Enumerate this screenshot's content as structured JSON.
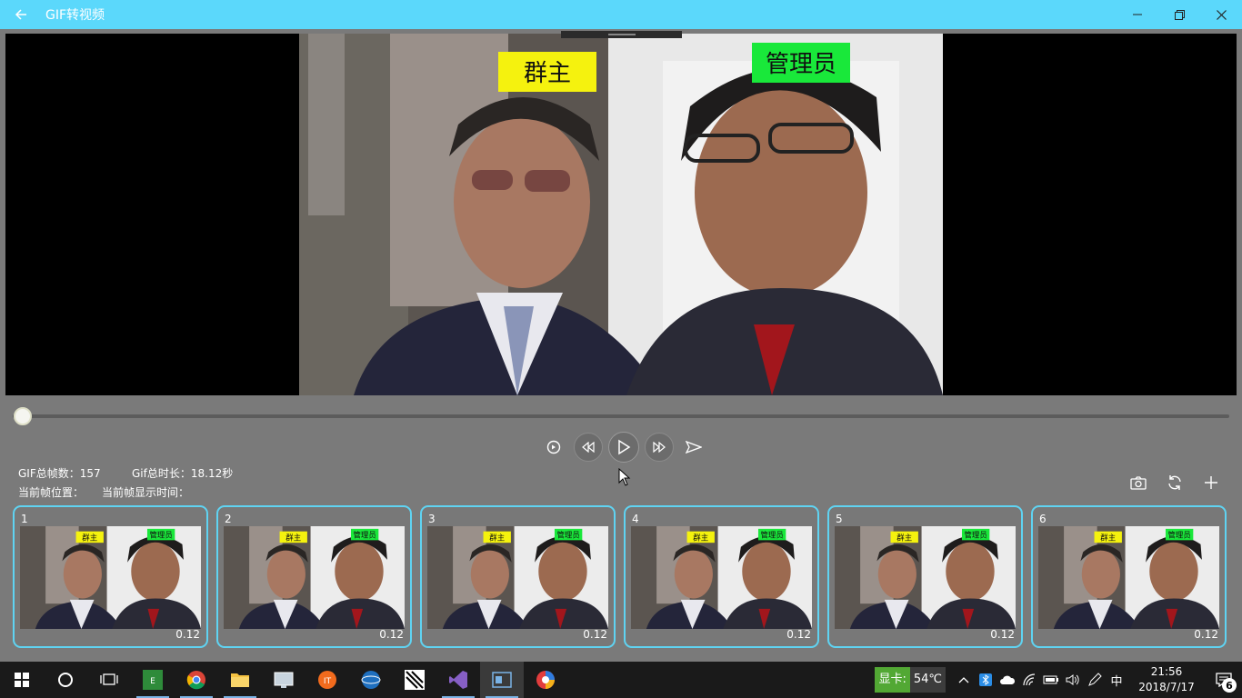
{
  "window": {
    "title": "GIF转视频",
    "back_icon": "arrow-left-icon",
    "minimize_icon": "minimize-icon",
    "restore_icon": "restore-icon",
    "close_icon": "close-icon"
  },
  "viewer": {
    "overlay_labels": [
      "群主",
      "管理员"
    ],
    "slider_position": 0
  },
  "transport": {
    "buttons": [
      "loop-icon",
      "rewind-icon",
      "play-icon",
      "fast-forward-icon",
      "send-icon"
    ]
  },
  "info": {
    "frame_count_label": "GIF总帧数：157",
    "duration_label": "Gif总时长：18.12秒",
    "current_frame_label": "当前帧位置：",
    "current_display_time_label": "当前帧显示时间："
  },
  "tools": [
    "camera-icon",
    "refresh-icon",
    "add-icon"
  ],
  "thumbnails": [
    {
      "index": "1",
      "duration": "0.12",
      "labels": [
        "群主",
        "管理员"
      ]
    },
    {
      "index": "2",
      "duration": "0.12",
      "labels": [
        "群主",
        "管理员"
      ]
    },
    {
      "index": "3",
      "duration": "0.12",
      "labels": [
        "群主",
        "管理员"
      ]
    },
    {
      "index": "4",
      "duration": "0.12",
      "labels": [
        "群主",
        "管理员"
      ]
    },
    {
      "index": "5",
      "duration": "0.12",
      "labels": [
        "群主",
        "管理员"
      ]
    },
    {
      "index": "6",
      "duration": "0.12",
      "labels": [
        "群主",
        "管理员"
      ]
    }
  ],
  "taskbar": {
    "icons": [
      "windows-start-icon",
      "cortana-icon",
      "task-view-icon",
      "app-icon",
      "chrome-icon",
      "file-explorer-icon",
      "app-icon",
      "app-icon",
      "app-icon",
      "app-icon",
      "visual-studio-icon",
      "app-icon",
      "app-icon"
    ],
    "gpu_label": "显卡:",
    "gpu_temp": "54℃",
    "ime": "中",
    "time": "21:56",
    "date": "2018/7/17",
    "notification_count": "6"
  },
  "colors": {
    "titlebar": "#5bd8fb",
    "panel": "#7a7a7a",
    "thumb_border": "#5fd3f2",
    "label_yellow": "#f5f20e",
    "label_green": "#19e83a"
  }
}
